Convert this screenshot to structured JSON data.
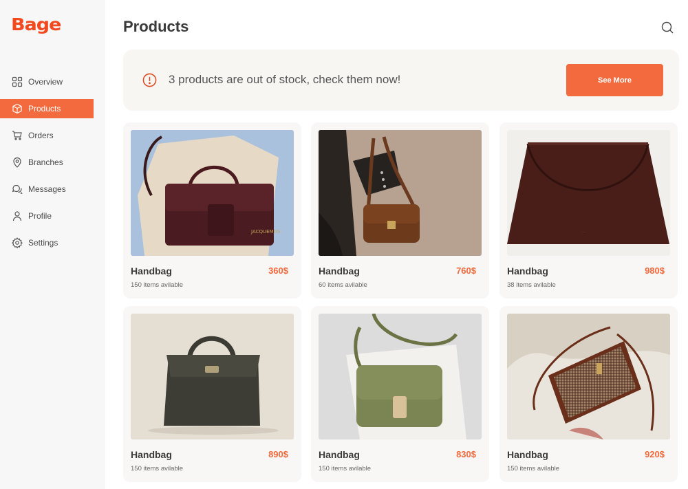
{
  "brand": {
    "logo_text": "Bage",
    "accent": "#f26a3d"
  },
  "sidebar": {
    "items": [
      {
        "label": "Overview",
        "icon": "grid-icon",
        "active": false
      },
      {
        "label": "Products",
        "icon": "box-icon",
        "active": true
      },
      {
        "label": "Orders",
        "icon": "cart-icon",
        "active": false
      },
      {
        "label": "Branches",
        "icon": "map-pin-icon",
        "active": false
      },
      {
        "label": "Messages",
        "icon": "chat-icon",
        "active": false
      },
      {
        "label": "Profile",
        "icon": "user-icon",
        "active": false
      },
      {
        "label": "Settings",
        "icon": "gear-icon",
        "active": false
      }
    ]
  },
  "header": {
    "title": "Products",
    "search_icon": "search-icon"
  },
  "alert": {
    "icon": "alert-circle-icon",
    "text": "3 products are out of stock, check them now!",
    "button_label": "See More"
  },
  "products": [
    {
      "name": "Handbag",
      "price": "360$",
      "stock": "150 items avilable",
      "image": "burgundy-flap-bag-photo"
    },
    {
      "name": "Handbag",
      "price": "760$",
      "stock": "60 items avilable",
      "image": "brown-shoulder-bag-photo"
    },
    {
      "name": "Handbag",
      "price": "980$",
      "stock": "38 items avilable",
      "image": "dark-brown-tote-photo"
    },
    {
      "name": "Handbag",
      "price": "890$",
      "stock": "150 items avilable",
      "image": "olive-top-handle-bag-photo"
    },
    {
      "name": "Handbag",
      "price": "830$",
      "stock": "150 items avilable",
      "image": "green-crossbody-bag-photo"
    },
    {
      "name": "Handbag",
      "price": "920$",
      "stock": "150 items avilable",
      "image": "tweed-crossbody-bag-photo"
    }
  ]
}
